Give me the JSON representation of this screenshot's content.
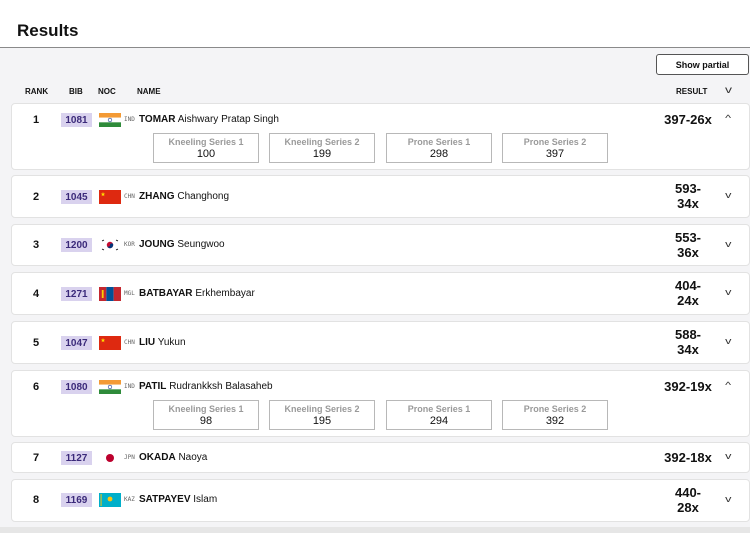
{
  "header": {
    "title": "Results"
  },
  "toolbar": {
    "show_partial_label": "Show partial"
  },
  "columns": {
    "rank": "RANK",
    "bib": "BIB",
    "noc": "NOC",
    "name": "NAME",
    "result": "RESULT"
  },
  "rows": [
    {
      "rank": "1",
      "bib": "1081",
      "noc": "IND",
      "flag": "india-flag-icon",
      "surname": "TOMAR",
      "given": "Aishwary Pratap Singh",
      "result": "397-26x",
      "expanded": true,
      "series": [
        {
          "label": "Kneeling Series 1",
          "value": "100"
        },
        {
          "label": "Kneeling Series 2",
          "value": "199"
        },
        {
          "label": "Prone Series 1",
          "value": "298"
        },
        {
          "label": "Prone Series 2",
          "value": "397"
        }
      ]
    },
    {
      "rank": "2",
      "bib": "1045",
      "noc": "CHN",
      "flag": "china-flag-icon",
      "surname": "ZHANG",
      "given": "Changhong",
      "result_line1": "593-",
      "result_line2": "34x",
      "expanded": false
    },
    {
      "rank": "3",
      "bib": "1200",
      "noc": "KOR",
      "flag": "korea-flag-icon",
      "surname": "JOUNG",
      "given": "Seungwoo",
      "result_line1": "553-",
      "result_line2": "36x",
      "expanded": false
    },
    {
      "rank": "4",
      "bib": "1271",
      "noc": "MGL",
      "flag": "mongolia-flag-icon",
      "surname": "BATBAYAR",
      "given": "Erkhembayar",
      "result_line1": "404-",
      "result_line2": "24x",
      "expanded": false
    },
    {
      "rank": "5",
      "bib": "1047",
      "noc": "CHN",
      "flag": "china-flag-icon",
      "surname": "LIU",
      "given": "Yukun",
      "result_line1": "588-",
      "result_line2": "34x",
      "expanded": false
    },
    {
      "rank": "6",
      "bib": "1080",
      "noc": "IND",
      "flag": "india-flag-icon",
      "surname": "PATIL",
      "given": "Rudrankksh Balasaheb",
      "result": "392-19x",
      "expanded": true,
      "series": [
        {
          "label": "Kneeling Series 1",
          "value": "98"
        },
        {
          "label": "Kneeling Series 2",
          "value": "195"
        },
        {
          "label": "Prone Series 1",
          "value": "294"
        },
        {
          "label": "Prone Series 2",
          "value": "392"
        }
      ]
    },
    {
      "rank": "7",
      "bib": "1127",
      "noc": "JPN",
      "flag": "japan-flag-icon",
      "surname": "OKADA",
      "given": "Naoya",
      "result": "392-18x",
      "expanded": false
    },
    {
      "rank": "8",
      "bib": "1169",
      "noc": "KAZ",
      "flag": "kazakhstan-flag-icon",
      "surname": "SATPAYEV",
      "given": "Islam",
      "result_line1": "440-",
      "result_line2": "28x",
      "expanded": false
    }
  ],
  "colors": {
    "bib_bg": "#d9d2ee",
    "bib_text": "#3b2a7a",
    "series_label": "#9a9a9a"
  }
}
